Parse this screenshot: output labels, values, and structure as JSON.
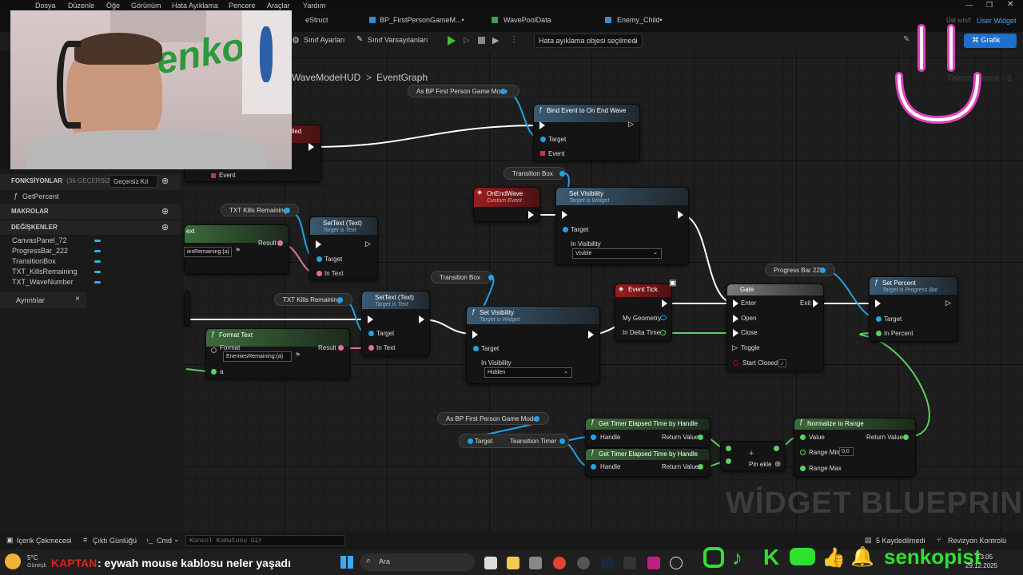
{
  "menu": [
    "Dosya",
    "Düzenle",
    "Öğe",
    "Görünüm",
    "Hata Ayıklama",
    "Pencere",
    "Araçlar",
    "Yardım"
  ],
  "tabs": [
    "eStruct",
    "BP_FirstPersonGameM...•",
    "WavePoolData",
    "Enemy_Child•"
  ],
  "parent_class": {
    "label": "Üst sınıf:",
    "value": "User Widget"
  },
  "toolbar": {
    "class_settings": "Sınıf Ayarları",
    "class_defaults": "Sınıf Varsayılanları",
    "debug_select": "Hata ayıklama objesi seçilmedi",
    "graph_btn": "Grafik",
    "top_right_hint": "Takim... ama - 1"
  },
  "breadcrumb": {
    "root": "WaveModeHUD",
    "sep": ">",
    "current": "EventGraph"
  },
  "left": {
    "functions_label": "FONKSİYONLAR",
    "functions_count": "(36 GEÇERSİZ KILIN",
    "override_btn": "Geçersiz Kıl",
    "function_item": "GetPercent",
    "macros": "MAKROLAR",
    "variables": "DEĞİŞKENLER",
    "vars": [
      "CanvasPanel_72",
      "ProgressBar_222",
      "TransitionBox",
      "TXT_KillsRemaining",
      "TXT_WaveNumber"
    ],
    "details_tab": "Ayrıntılar",
    "details_close": "×"
  },
  "nodes": {
    "as_bp1": "As BP First Person Game Mode",
    "bind": {
      "title": "Bind Event to On End Wave",
      "target": "Target",
      "event": "Event"
    },
    "killed": "illed",
    "event_pin": "Event",
    "tb1": "Transition Box",
    "onendwave": {
      "title": "OnEndWave",
      "sub": "Custom Event"
    },
    "setvis1": {
      "title": "Set Visibility",
      "sub": "Target is Widget",
      "target": "Target",
      "invis": "In Visibility",
      "value": "Visible"
    },
    "txtkills1": "TXT Kills Remaining",
    "settext1": {
      "title": "SetText (Text)",
      "sub": "Target is Text",
      "target": "Target",
      "intext": "In Text"
    },
    "formatfrag": {
      "title": "ext",
      "field": "iesRemaining:{a}",
      "result": "Result"
    },
    "tb2": "Transition Box",
    "txtkills2": "TXT Kills Remaining",
    "settext2": {
      "title": "SetText (Text)",
      "sub": "Target is Text",
      "target": "Target",
      "intext": "In Text"
    },
    "formattext": {
      "title": "Format Text",
      "format": "Format",
      "field": "EnemiesRemaining:{a}",
      "result": "Result",
      "a": "a"
    },
    "setvis2": {
      "title": "Set Visibility",
      "sub": "Target is Widget",
      "target": "Target",
      "invis": "In Visibility",
      "value": "Hidden"
    },
    "eventtick": {
      "title": "Event Tick",
      "geometry": "My Geometry",
      "delta": "In Delta Time"
    },
    "gate": {
      "title": "Gate",
      "enter": "Enter",
      "exit": "Exit",
      "open": "Open",
      "close": "Close",
      "toggle": "Toggle",
      "closed": "Start Closed"
    },
    "progressbar": "Progress Bar 222",
    "setpercent": {
      "title": "Set Percent",
      "sub": "Target is Progress Bar",
      "target": "Target",
      "inpercent": "In Percent"
    },
    "as_bp2": "As BP First Person Game Mode",
    "transtimer": {
      "target": "Target",
      "label": "Teansition Timer"
    },
    "timer1": {
      "title": "Get Timer Elapsed Time by Handle",
      "handle": "Handle",
      "ret": "Return Value"
    },
    "timer2": {
      "title": "Get Timer Elapsed Time by Handle",
      "handle": "Handle",
      "ret": "Return Value"
    },
    "add": {
      "label": "Pin ekle",
      "plus": "+"
    },
    "normalize": {
      "title": "Normalize to Range",
      "value": "Value",
      "ret": "Return Value",
      "min": "Range Min",
      "minval": "0,0",
      "max": "Range Max"
    }
  },
  "watermark": "WİDGET BLUEPRINT'İ",
  "bottom": {
    "content": "İçerik Çekmecesi",
    "output": "Çıktı Günlüğü",
    "cmd": "Cmd",
    "console": "Konsol Komutunu Gir",
    "saved": "5 Kaydedilmedi",
    "revision": "Revizyon Kontrolü"
  },
  "taskbar": {
    "temp": "5°C",
    "weather": "Güneşli",
    "chat_user": "KAPTAN",
    "chat_msg": ": eywah mouse kablosu neler yaşadı",
    "search": "Ara",
    "time": "13:05",
    "date": "29.12.2025",
    "brand": "senkopist"
  },
  "webcam": {
    "text": "Senko"
  }
}
